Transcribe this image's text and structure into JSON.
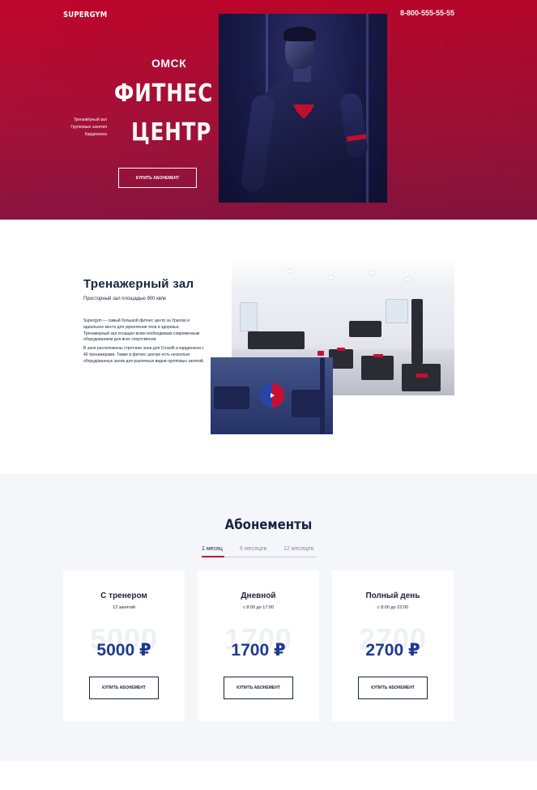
{
  "header": {
    "logo": "SUPERGYM",
    "phone": "8-800-555-55-55"
  },
  "hero": {
    "city": "ОМСК",
    "title_line1": "ФИТНЕС",
    "title_line2": "ЦЕНТР",
    "features": [
      "Тренажёрный зал",
      "Групповые занятия",
      "Кардиозона"
    ],
    "cta_label": "КУПИТЬ АБОНЕМЕНТ"
  },
  "gym": {
    "title": "Тренажерный зал",
    "subtitle": "Просторный зал площадью 900 кв/м",
    "paragraph1": "Supergym — самый большой фитнес центр за Уралом и идеальное место для укрепления тела и здоровья. Тренажерный зал оснащен всем необходимым современным оборудованием для всех спортсменов.",
    "paragraph2": "В зале расположены стретчинг зона для Crossfit и кардиозона с 40 тренажерами. Также в фитнес центре есть несколько оборудованных залов для различных видов групповых занятий."
  },
  "subscriptions": {
    "title": "Абонементы",
    "tabs": [
      "1 месяц",
      "6 месяцев",
      "12 месяцев"
    ],
    "active_tab": 0,
    "plans": [
      {
        "name": "С тренером",
        "note": "12 занятий",
        "ghost": "5000",
        "price": "5000 ₽",
        "cta": "КУПИТЬ АБОНЕМЕНТ"
      },
      {
        "name": "Дневной",
        "note": "с 8:00 до 17:00",
        "ghost": "1700",
        "price": "1700 ₽",
        "cta": "КУПИТЬ АБОНЕМЕНТ"
      },
      {
        "name": "Полный день",
        "note": "с 8:00 до 22:00",
        "ghost": "2700",
        "price": "2700 ₽",
        "cta": "КУПИТЬ АБОНЕМЕНТ"
      }
    ]
  },
  "icons": {
    "play": "play-icon"
  },
  "colors": {
    "accent_red": "#c0062c",
    "navy": "#1a2340",
    "price_blue": "#1d3a8f",
    "section_bg": "#f4f6fa"
  }
}
